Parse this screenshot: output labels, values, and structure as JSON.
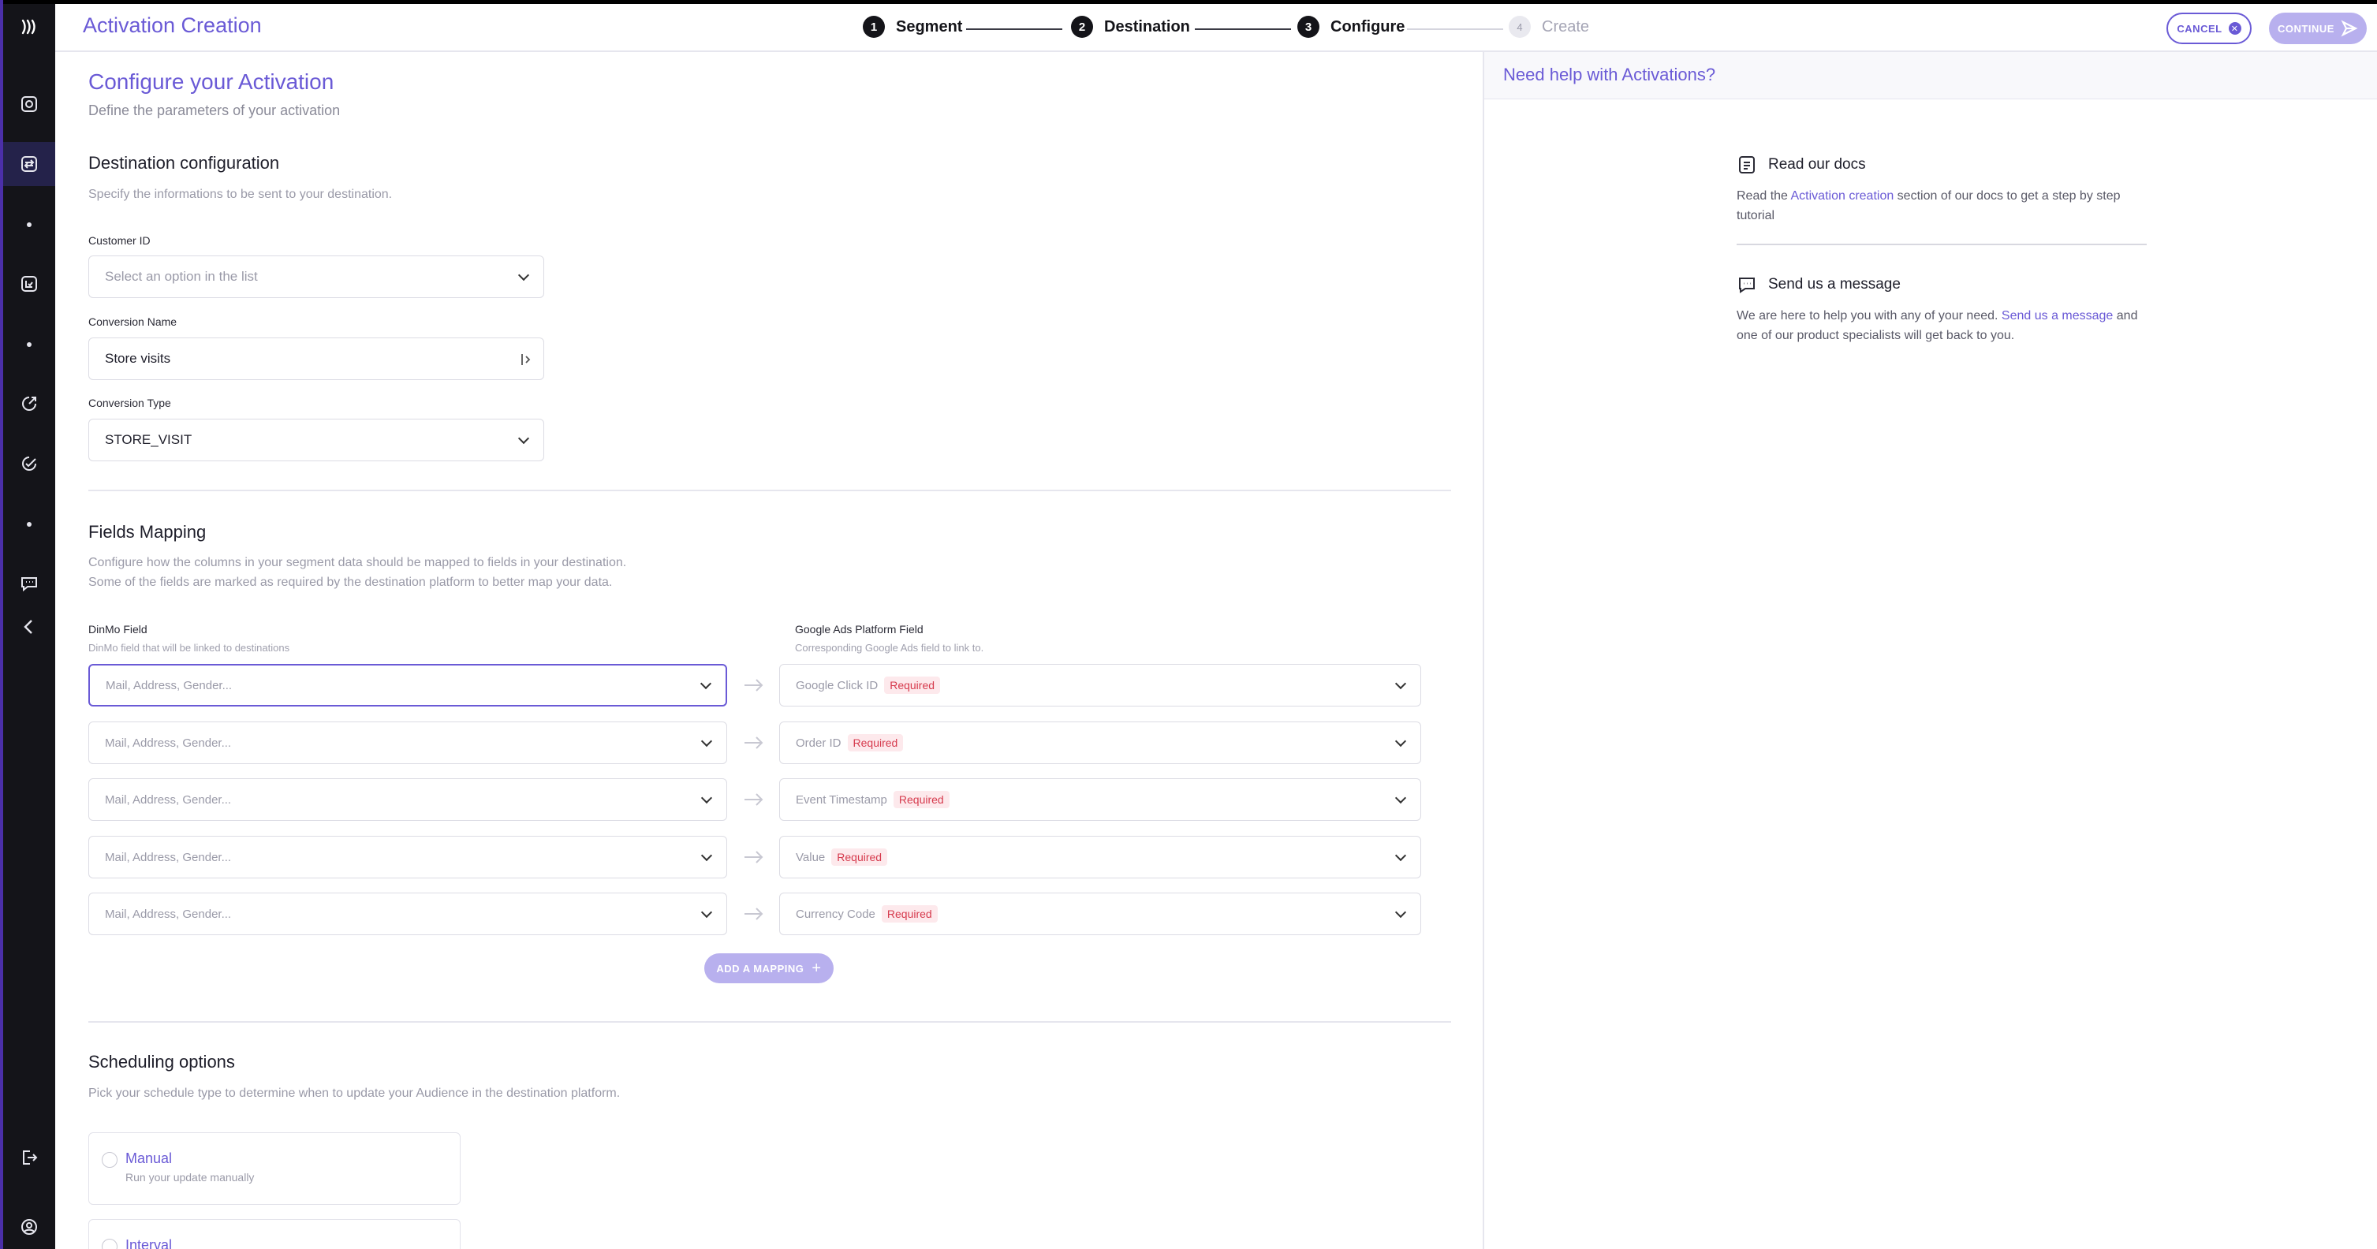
{
  "app": {
    "title": "Activation Creation"
  },
  "stepper": {
    "steps": [
      {
        "num": "1",
        "label": "Segment"
      },
      {
        "num": "2",
        "label": "Destination"
      },
      {
        "num": "3",
        "label": "Configure"
      },
      {
        "num": "4",
        "label": "Create"
      }
    ]
  },
  "actions": {
    "cancel_label": "CANCEL",
    "continue_label": "CONTINUE"
  },
  "page": {
    "title": "Configure your Activation",
    "subtitle": "Define the parameters of your activation"
  },
  "destination_config": {
    "heading": "Destination configuration",
    "description": "Specify the informations to be sent to your destination.",
    "customer_id": {
      "label": "Customer ID",
      "placeholder": "Select an option in the list"
    },
    "conversion_name": {
      "label": "Conversion Name",
      "value": "Store visits"
    },
    "conversion_type": {
      "label": "Conversion Type",
      "value": "STORE_VISIT"
    }
  },
  "fields_mapping": {
    "heading": "Fields Mapping",
    "description_line1": "Configure how the columns in your segment data should be mapped to fields in your destination.",
    "description_line2": "Some of the fields are marked as required by the destination platform to better map your data.",
    "source_col": {
      "title": "DinMo Field",
      "subtitle": "DinMo field that will be linked to destinations"
    },
    "dest_col": {
      "title": "Google Ads Platform Field",
      "subtitle": "Corresponding Google Ads field to link to."
    },
    "source_placeholder": "Mail, Address, Gender...",
    "required_label": "Required",
    "rows": [
      {
        "dest_field": "Google Click ID"
      },
      {
        "dest_field": "Order ID"
      },
      {
        "dest_field": "Event Timestamp"
      },
      {
        "dest_field": "Value"
      },
      {
        "dest_field": "Currency Code"
      }
    ],
    "add_label": "ADD A MAPPING"
  },
  "scheduling": {
    "heading": "Scheduling options",
    "description": "Pick your schedule type to determine when to update your Audience in the destination platform.",
    "options": [
      {
        "title": "Manual",
        "subtitle": "Run your update manually"
      },
      {
        "title": "Interval",
        "subtitle": ""
      }
    ]
  },
  "help": {
    "title": "Need help with Activations?",
    "docs": {
      "title": "Read our docs",
      "text_before": "Read the ",
      "link": "Activation creation",
      "text_after": " section of our docs to get a step by step tutorial"
    },
    "message": {
      "title": "Send us a message",
      "text_before": "We are here to help you with any of your need. ",
      "link": "Send us a message",
      "text_after": " and one of our product specialists will get back to you."
    }
  },
  "colors": {
    "accent": "#6a5ad6",
    "accent_light": "#b8b0ee",
    "rail": "#141419",
    "required_bg": "#fde9ec",
    "required_text": "#d63a4d"
  }
}
